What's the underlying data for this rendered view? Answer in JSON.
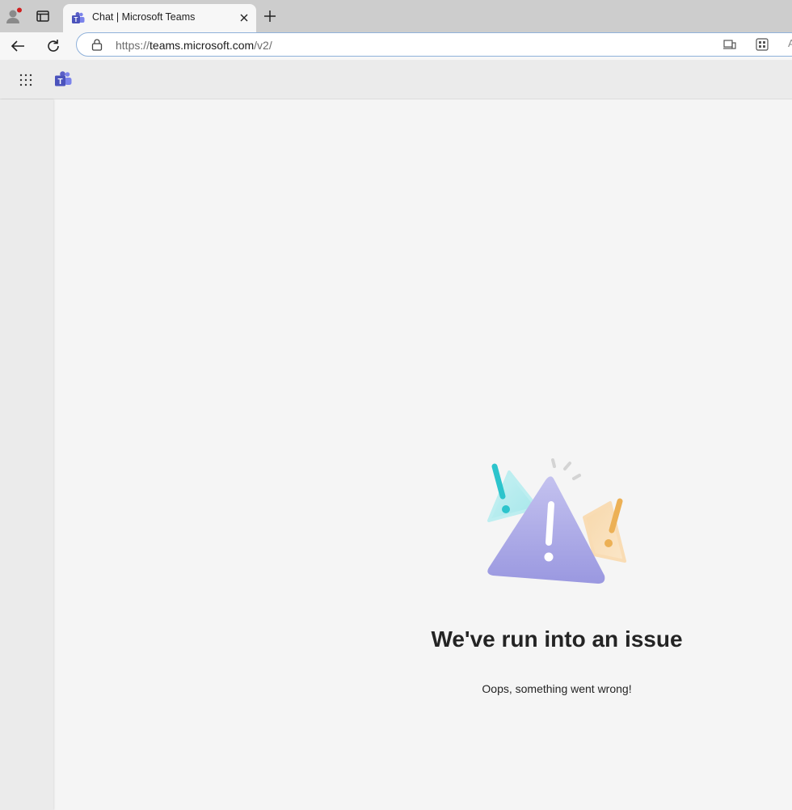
{
  "browser": {
    "tab": {
      "title": "Chat | Microsoft Teams",
      "favicon": "teams-icon"
    },
    "address_bar": {
      "url_prefix": "https://",
      "url_host": "teams.microsoft.com",
      "url_path": "/v2/",
      "partial_text": "A"
    }
  },
  "error": {
    "title": "We've run into an issue",
    "message": "Oops, something went wrong!"
  },
  "colors": {
    "teams_purple": "#5b5fc7",
    "triangle_main": "#a9a7e4",
    "triangle_cyan": "#2cc4cc",
    "triangle_orange": "#ecb055"
  }
}
